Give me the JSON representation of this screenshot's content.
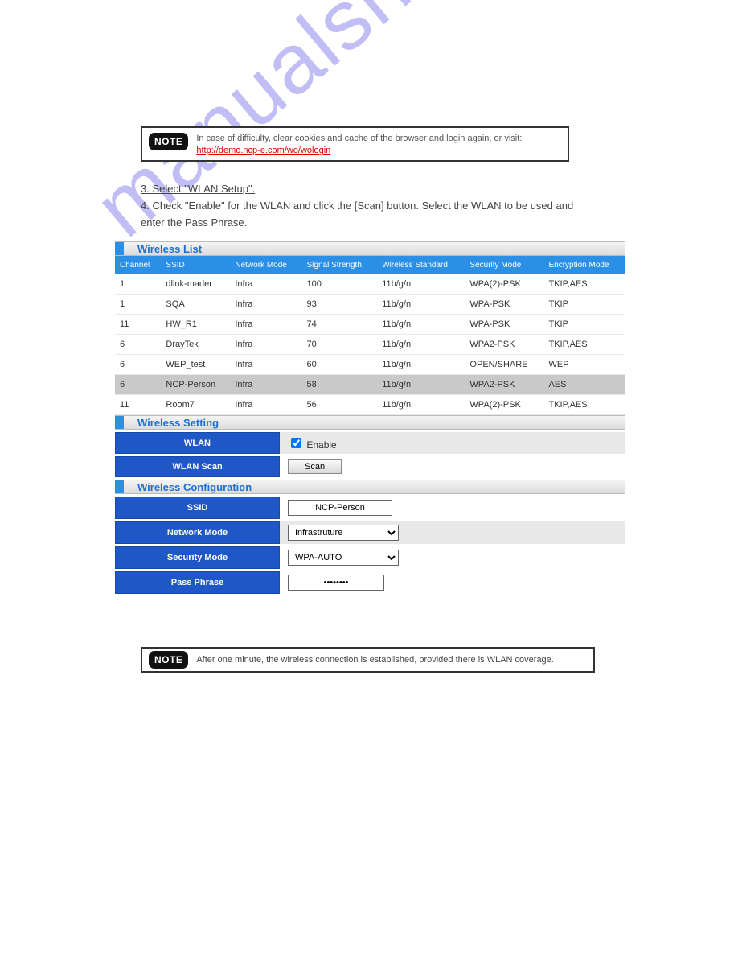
{
  "watermark": "manualshive.com",
  "upper_text": "",
  "note1": {
    "badge": "NOTE",
    "plain": "In case of difficulty, clear cookies and cache of the browser and login again, or visit:",
    "highlighted": "http://demo.ncp-e.com/wo/wologin"
  },
  "steps": {
    "s3": "3. Select \"WLAN Setup\".",
    "s4": "4. Check \"Enable\" for the WLAN and click the [Scan] button. Select the WLAN to be used and enter the Pass Phrase."
  },
  "wireless_list": {
    "title": "Wireless List",
    "columns": [
      "Channel",
      "SSID",
      "Network Mode",
      "Signal Strength",
      "Wireless Standard",
      "Security Mode",
      "Encryption Mode"
    ],
    "rows": [
      {
        "channel": "1",
        "ssid": "dlink-mader",
        "mode": "Infra",
        "signal": "100",
        "std": "11b/g/n",
        "sec": "WPA(2)-PSK",
        "enc": "TKIP,AES",
        "selected": false
      },
      {
        "channel": "1",
        "ssid": "SQA",
        "mode": "Infra",
        "signal": "93",
        "std": "11b/g/n",
        "sec": "WPA-PSK",
        "enc": "TKIP",
        "selected": false
      },
      {
        "channel": "11",
        "ssid": "HW_R1",
        "mode": "Infra",
        "signal": "74",
        "std": "11b/g/n",
        "sec": "WPA-PSK",
        "enc": "TKIP",
        "selected": false
      },
      {
        "channel": "6",
        "ssid": "DrayTek",
        "mode": "Infra",
        "signal": "70",
        "std": "11b/g/n",
        "sec": "WPA2-PSK",
        "enc": "TKIP,AES",
        "selected": false
      },
      {
        "channel": "6",
        "ssid": "WEP_test",
        "mode": "Infra",
        "signal": "60",
        "std": "11b/g/n",
        "sec": "OPEN/SHARE",
        "enc": "WEP",
        "selected": false
      },
      {
        "channel": "6",
        "ssid": "NCP-Person",
        "mode": "Infra",
        "signal": "58",
        "std": "11b/g/n",
        "sec": "WPA2-PSK",
        "enc": "AES",
        "selected": true
      },
      {
        "channel": "11",
        "ssid": "Room7",
        "mode": "Infra",
        "signal": "56",
        "std": "11b/g/n",
        "sec": "WPA(2)-PSK",
        "enc": "TKIP,AES",
        "selected": false
      }
    ]
  },
  "wireless_setting": {
    "title": "Wireless Setting",
    "rows": {
      "wlan_label": "WLAN",
      "wlan_enable_text": "Enable",
      "wlan_scan_label": "WLAN Scan",
      "scan_button": "Scan"
    }
  },
  "wireless_config": {
    "title": "Wireless Configuration",
    "rows": {
      "ssid_label": "SSID",
      "ssid_value": "NCP-Person",
      "netmode_label": "Network Mode",
      "netmode_value": "Infrastruture",
      "secmode_label": "Security Mode",
      "secmode_value": "WPA-AUTO",
      "pass_label": "Pass Phrase",
      "pass_value": "••••••••"
    }
  },
  "note2": {
    "badge": "NOTE",
    "text": "After one minute, the wireless connection is established, provided there is WLAN coverage."
  }
}
